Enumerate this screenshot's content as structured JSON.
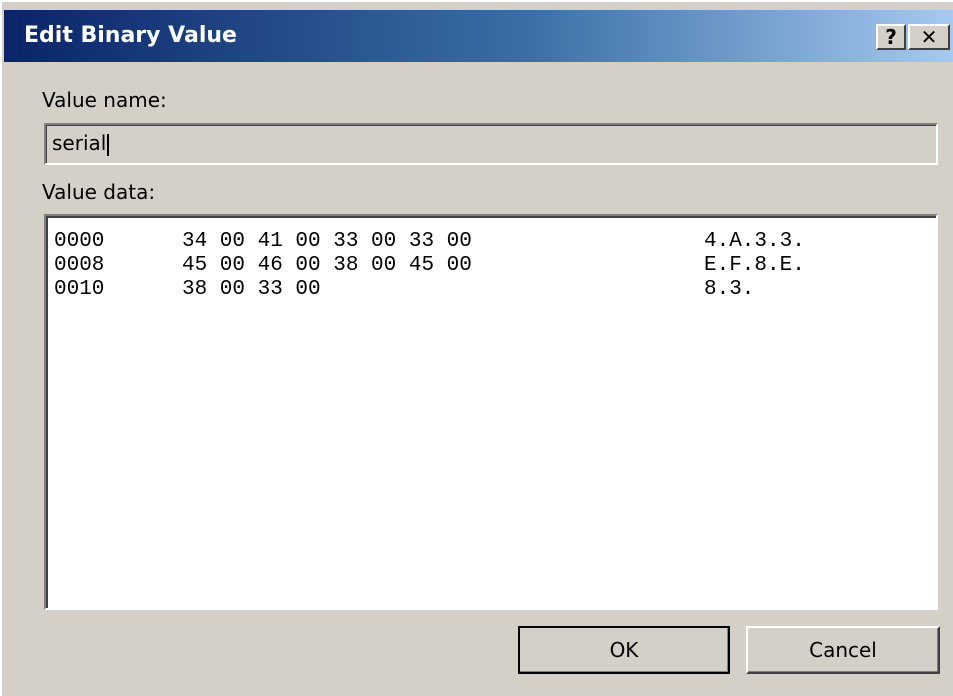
{
  "window": {
    "title": "Edit Binary Value",
    "help_button_label": "?",
    "close_button_label": "✕"
  },
  "value_name": {
    "label": "Value name:",
    "value": "serial"
  },
  "value_data": {
    "label": "Value data:",
    "rows": [
      {
        "offset": "0000",
        "hex": "34 00 41 00 33 00 33 00",
        "ascii": "4.A.3.3."
      },
      {
        "offset": "0008",
        "hex": "45 00 46 00 38 00 45 00",
        "ascii": "E.F.8.E."
      },
      {
        "offset": "0010",
        "hex": "38 00 33 00",
        "ascii": "8.3."
      }
    ]
  },
  "buttons": {
    "ok_label": "OK",
    "cancel_label": "Cancel"
  },
  "colors": {
    "dialog_face": "#d4d0c8",
    "titlebar_start": "#0a246a",
    "titlebar_end": "#a6caf0"
  }
}
